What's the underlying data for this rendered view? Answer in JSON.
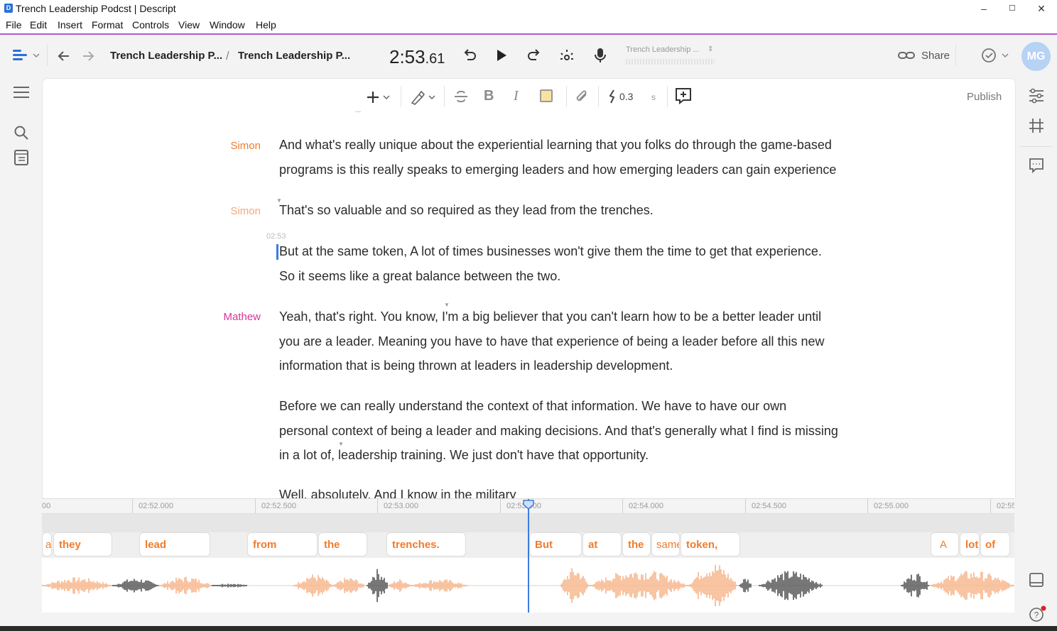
{
  "window": {
    "title": "Trench Leadership Podcst | Descript",
    "app_icon": "descript-app-icon",
    "controls": [
      "–",
      "☐",
      "✕"
    ]
  },
  "menu": [
    "File",
    "Edit",
    "Insert",
    "Format",
    "Controls",
    "View",
    "Window",
    "Help"
  ],
  "toolbar": {
    "breadcrumb": [
      "Trench Leadership P...",
      "Trench Leadership P..."
    ],
    "breadcrumb_sep": "/",
    "time_main": "2:53",
    "time_frac": ".61",
    "track_name": "Trench Leadership ...",
    "share_label": "Share",
    "avatar_initials": "MG",
    "accent": "#b6d2f5"
  },
  "format_bar": {
    "pause_value": "0.3",
    "pause_unit": "s",
    "publish_label": "Publish"
  },
  "transcript": [
    {
      "speaker": "Simon",
      "speaker_color": "#f07b2c",
      "lines": [
        "And what's really unique about the experiential learning that you folks do through the game-based",
        "programs is this really speaks to emerging leaders and how emerging leaders can gain experience"
      ]
    },
    {
      "speaker": "Simon",
      "speaker_color": "#f5a878",
      "lines": [
        "That's so valuable and so required as they lead from the trenches."
      ]
    },
    {
      "timestamp": "02:53",
      "lines": [
        "But at the same token, A lot of times businesses won't give them the time to get that experience.",
        "So it seems like a great balance between the two."
      ]
    },
    {
      "speaker": "Mathew",
      "speaker_color": "#d4369a",
      "lines": [
        "Yeah, that's right. You know,  I'm a big believer that you can't learn how to be a better leader until",
        "you are a leader. Meaning you have to have that experience of being a leader before all this new",
        "information that is being thrown at leaders in leadership development."
      ]
    },
    {
      "lines": [
        "Before we can really understand the context of that information. We have to have our own",
        "personal context of being a leader and making decisions. And that's generally what I find is missing",
        "in a lot of, leadership training. We just don't have that opportunity."
      ]
    },
    {
      "lines": [
        "Well, absolutely. And I know in the military"
      ]
    }
  ],
  "timeline": {
    "ticks": [
      "00",
      "02:52.000",
      "02:52.500",
      "02:53.000",
      "02:53.500",
      "02:54.000",
      "02:54.500",
      "02:55.000",
      "02:55"
    ],
    "words": [
      "a",
      "they",
      "lead",
      "from",
      "the",
      "trenches.",
      "But",
      "at",
      "the",
      "same",
      "token,",
      "A",
      "lot",
      "of"
    ],
    "word_color": "#f07b2c",
    "wave_color": "#f7b68a",
    "wave_dark": "#555555",
    "playhead_color": "#3d7be0"
  },
  "icons": {
    "left_rail": [
      "hamburger-menu-icon",
      "search-icon",
      "notebook-icon"
    ],
    "right_rail": [
      "properties-icon",
      "grid-icon",
      "comment-icon",
      "panel-icon",
      "help-icon"
    ]
  }
}
